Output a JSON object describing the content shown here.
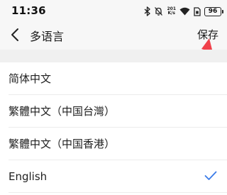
{
  "status_bar": {
    "time": "11:36",
    "net_speed_value": "201",
    "net_speed_unit": "K/s",
    "battery": "96",
    "icons": [
      "bluetooth-icon",
      "mute-icon",
      "net-speed-indicator",
      "wifi-icon",
      "sim-icon",
      "battery-icon"
    ]
  },
  "header": {
    "title": "多语言",
    "save_label": "保存"
  },
  "languages": [
    {
      "label": "简体中文",
      "selected": false
    },
    {
      "label": "繁體中文（中国台灣）",
      "selected": false
    },
    {
      "label": "繁體中文（中国香港）",
      "selected": false
    },
    {
      "label": "English",
      "selected": true
    }
  ],
  "colors": {
    "accent_check": "#3a7be8",
    "annotation_arrow": "#f0414b",
    "header_bg": "#f7f7f7",
    "divider": "#ececec"
  }
}
